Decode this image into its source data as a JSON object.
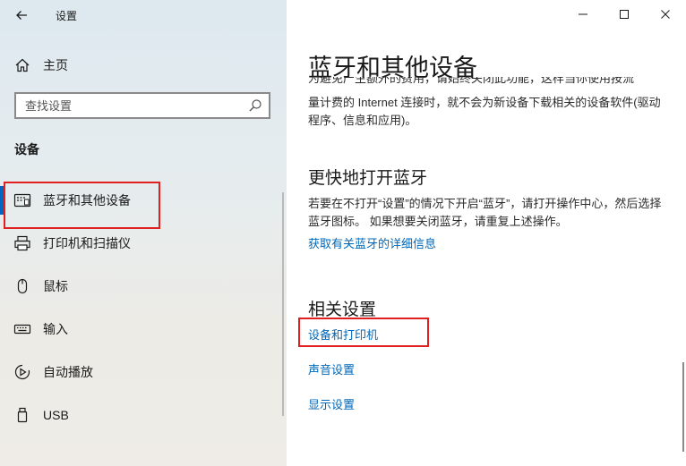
{
  "window": {
    "title": "设置",
    "minimize_icon": "minimize-icon",
    "maximize_icon": "maximize-icon",
    "close_icon": "close-icon"
  },
  "sidebar": {
    "home_label": "主页",
    "search": {
      "placeholder": "查找设置",
      "value": ""
    },
    "section_label": "设备",
    "items": [
      {
        "label": "蓝牙和其他设备",
        "icon": "bluetooth-devices-icon",
        "selected": true
      },
      {
        "label": "打印机和扫描仪",
        "icon": "printer-icon"
      },
      {
        "label": "鼠标",
        "icon": "mouse-icon"
      },
      {
        "label": "输入",
        "icon": "keyboard-icon"
      },
      {
        "label": "自动播放",
        "icon": "autoplay-icon"
      },
      {
        "label": "USB",
        "icon": "usb-icon"
      }
    ]
  },
  "main": {
    "page_title": "蓝牙和其他设备",
    "partial_text_cut": "为避免产生额外的费用，请始终关闭此功能，这样当你使用按流",
    "metered_text": "量计费的 Internet 连接时，就不会为新设备下载相关的设备软件(驱动程序、信息和应用)。",
    "faster_bt": {
      "heading": "更快地打开蓝牙",
      "text": "若要在不打开“设置”的情况下开启“蓝牙”，请打开操作中心，然后选择蓝牙图标。 如果想要关闭蓝牙，请重复上述操作。",
      "link": "获取有关蓝牙的详细信息"
    },
    "related": {
      "heading": "相关设置",
      "links": [
        "设备和打印机",
        "声音设置",
        "显示设置"
      ]
    }
  },
  "colors": {
    "accent": "#0067b8",
    "highlight": "#e02020",
    "selected_bar": "#0067c0"
  }
}
